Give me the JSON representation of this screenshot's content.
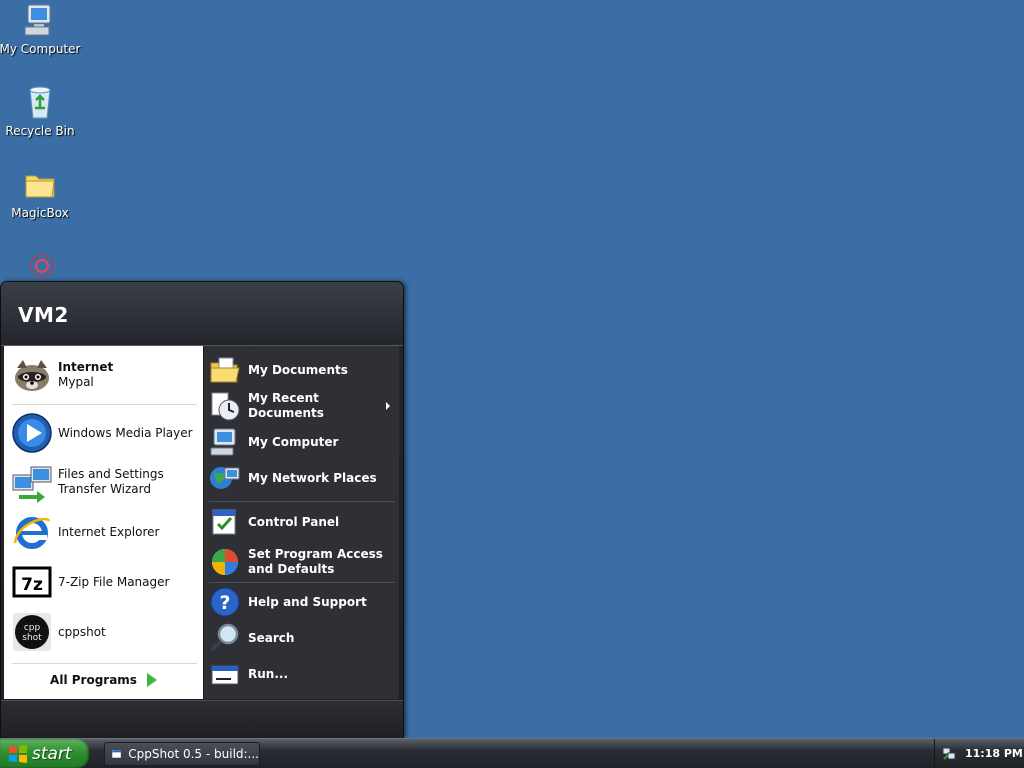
{
  "desktop": {
    "icons": [
      {
        "label": "My Computer",
        "icon": "my-computer-icon"
      },
      {
        "label": "Recycle Bin",
        "icon": "recycle-bin-icon"
      },
      {
        "label": "MagicBox",
        "icon": "folder-icon"
      },
      {
        "label": "",
        "icon": "red-burst-icon"
      }
    ]
  },
  "start_menu": {
    "user_name": "VM2",
    "pinned": [
      {
        "title": "Internet",
        "subtitle": "Mypal",
        "icon": "raccoon-browser-icon"
      }
    ],
    "recent": [
      {
        "label": "Windows Media Player",
        "icon": "media-player-icon"
      },
      {
        "label": "Files and Settings Transfer Wizard",
        "icon": "transfer-wizard-icon"
      },
      {
        "label": "Internet Explorer",
        "icon": "internet-explorer-icon"
      },
      {
        "label": "7-Zip File Manager",
        "icon": "seven-zip-icon"
      },
      {
        "label": "cppshot",
        "icon": "cppshot-icon"
      }
    ],
    "all_programs": "All Programs",
    "right": {
      "my_documents": "My Documents",
      "my_recent_documents": "My Recent Documents",
      "my_computer": "My Computer",
      "my_network_places": "My Network Places",
      "control_panel": "Control Panel",
      "set_program_access": "Set Program Access and Defaults",
      "help_and_support": "Help and Support",
      "search": "Search",
      "run": "Run..."
    }
  },
  "taskbar": {
    "start_label": "start",
    "tasks": [
      {
        "label": "CppShot 0.5 - build:...",
        "icon": "window-icon"
      }
    ],
    "clock": "11:18 PM",
    "tray_icons": [
      "network-icon"
    ]
  },
  "colors": {
    "desktop_bg": "#3a6ea5",
    "start_green": "#2f8f33",
    "menu_dark": "#2f3036"
  }
}
